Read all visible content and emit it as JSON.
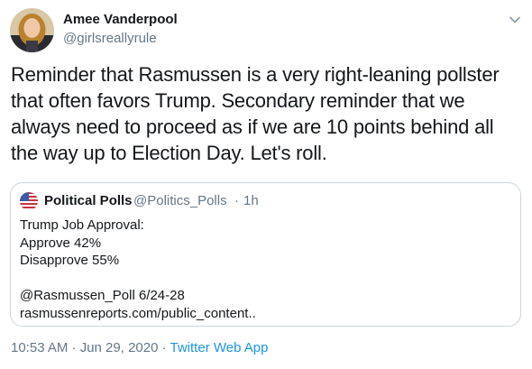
{
  "author": {
    "name": "Amee Vanderpool",
    "handle": "@girlsreallyrule"
  },
  "tweet": {
    "lines": [
      "Reminder that Rasmussen is a very right-leaning pollster",
      "that often favors Trump. Secondary reminder that we",
      "always need to proceed as if we are 10 points behind all",
      "the way up to Election Day. Let's roll."
    ]
  },
  "quoted_tweet": {
    "name": "Political Polls",
    "handle": "@Politics_Polls",
    "separator": "·",
    "time": "1h",
    "lines": [
      "Trump Job Approval:",
      "Approve 42%",
      "Disapprove 55%",
      "",
      "@Rasmussen_Poll 6/24-28",
      "rasmussenreports.com/public_content.."
    ]
  },
  "meta": {
    "timestamp": "10:53 AM · Jun 29, 2020 · ",
    "app": "Twitter Web App"
  },
  "icons": {
    "menu": "chevron-down-icon",
    "avatar": "avatar",
    "quoted_avatar": "us-flag-avatar"
  },
  "colors": {
    "text": "#14171a",
    "secondary": "#657786",
    "link": "#1b95e0",
    "border": "#ccd6dd"
  }
}
